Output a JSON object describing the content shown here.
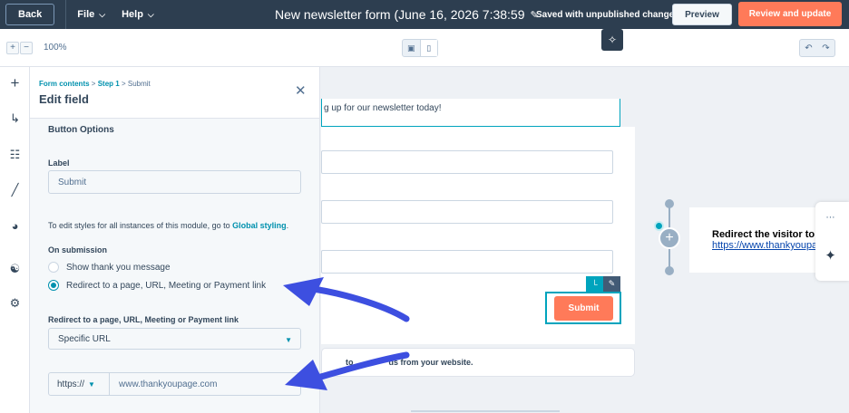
{
  "topbar": {
    "back_label": "Back",
    "file_label": "File",
    "help_label": "Help",
    "title": "New newsletter form (June 16, 2026 7:38:59",
    "status": "Saved with unpublished changes",
    "preview_label": "Preview",
    "review_label": "Review and update"
  },
  "toolbar": {
    "zoom_in": "+",
    "zoom_out": "−",
    "zoom_level": "100%"
  },
  "panel": {
    "breadcrumb": {
      "root": "Form contents",
      "step": "Step 1",
      "current": "Submit",
      "separator": ">"
    },
    "title": "Edit field",
    "section_title": "Button Options",
    "label_heading": "Label",
    "label_value": "Submit",
    "styles_note_prefix": "To edit styles for all instances of this module, go to",
    "styles_note_link": "Global styling",
    "styles_note_suffix": ".",
    "submission_heading": "On submission",
    "options": [
      {
        "label": "Show thank you message",
        "selected": false
      },
      {
        "label": "Redirect to a page, URL, Meeting or Payment link",
        "selected": true
      }
    ],
    "redirect_heading": "Redirect to a page, URL, Meeting or Payment link",
    "redirect_type": "Specific URL",
    "url_protocol": "https://",
    "url_value": "www.thankyoupage.com"
  },
  "canvas": {
    "intro_text": "g up for our newsletter today!",
    "submit_label": "Submit",
    "collect_text_prefix": "to ",
    "collect_text_suffix": "ds from your website."
  },
  "flow": {
    "redirect_title": "Redirect the visitor to:",
    "redirect_url": "https://www.thankyoupage"
  },
  "colors": {
    "topbar": "#2d3e50",
    "accent_orange": "#ff7a59",
    "accent_teal": "#0091ae",
    "arrow_blue": "#3d4fe0"
  }
}
